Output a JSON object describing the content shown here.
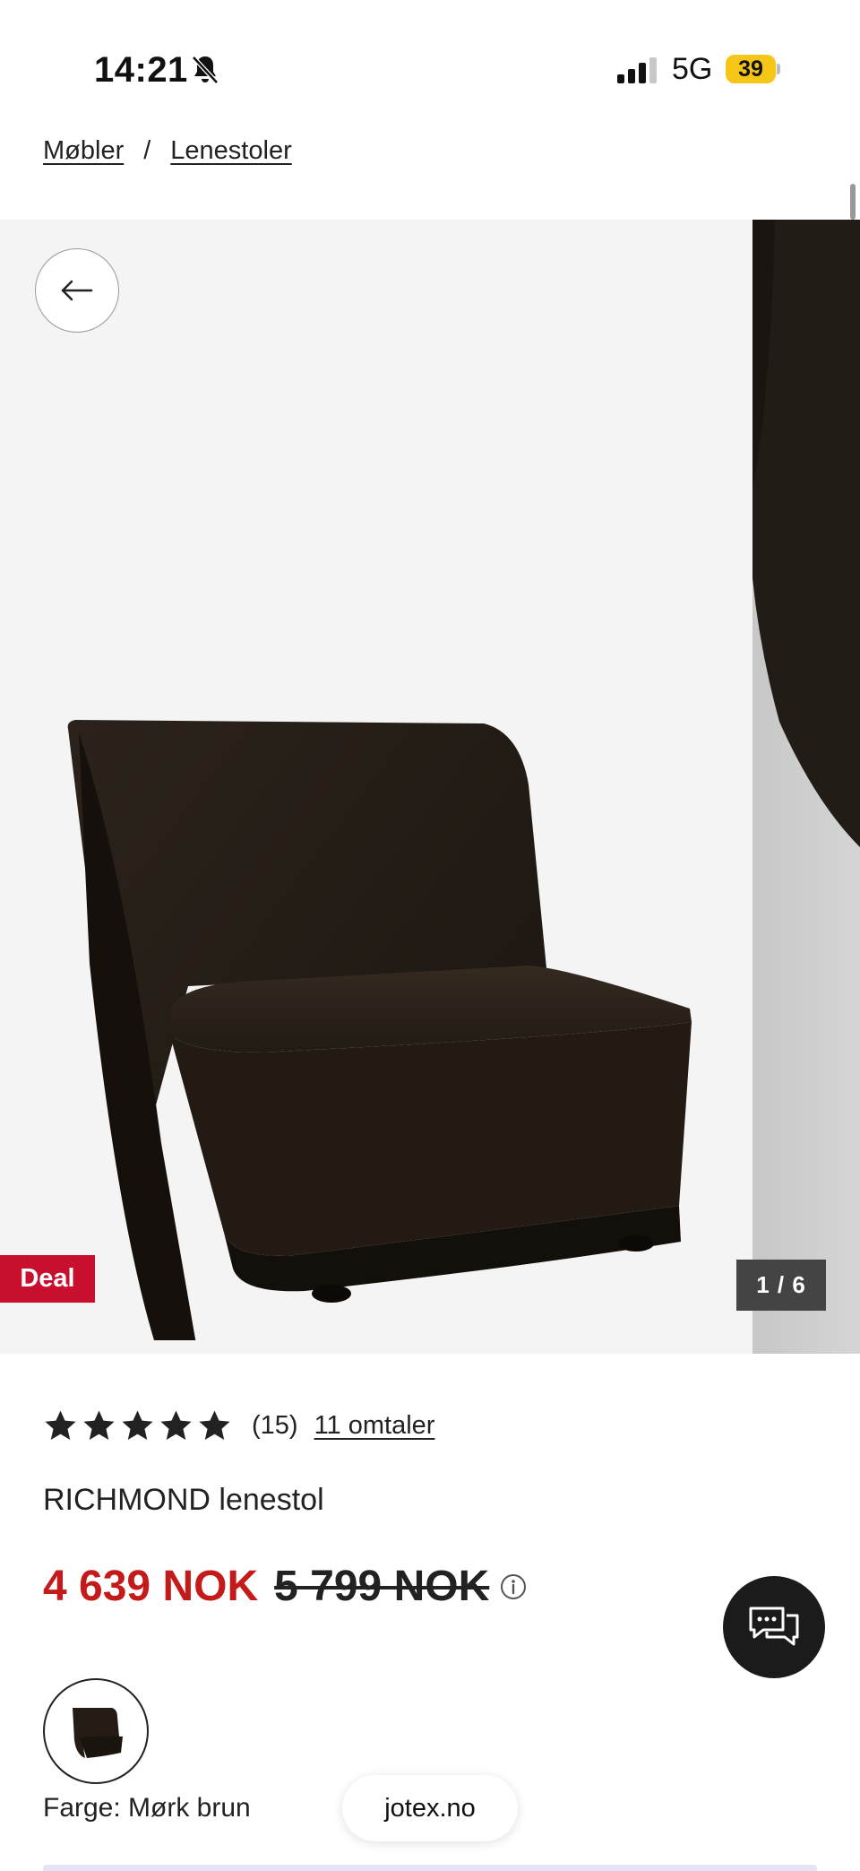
{
  "status_bar": {
    "time": "14:21",
    "network": "5G",
    "battery": "39"
  },
  "breadcrumb": {
    "items": [
      "Møbler",
      "Lenestoler"
    ],
    "separator": "/"
  },
  "gallery": {
    "deal_badge": "Deal",
    "counter": "1 / 6",
    "current_image": 1,
    "total_images": 6
  },
  "product": {
    "rating": 5,
    "rating_count": "(15)",
    "reviews_link": "11 omtaler",
    "title": "RICHMOND lenestol",
    "price_current": "4 639 NOK",
    "price_original": "5 799 NOK",
    "color_label": "Farge: Mørk brun"
  },
  "browser": {
    "url": "jotex.no"
  },
  "colors": {
    "sale_red": "#c41a1a",
    "deal_red": "#c8102e",
    "chair_brown": "#2a221a",
    "battery_yellow": "#f5c518"
  },
  "icons": [
    "bell-slash-icon",
    "signal-icon",
    "back-arrow-icon",
    "star-icon",
    "info-icon",
    "chat-icon"
  ]
}
